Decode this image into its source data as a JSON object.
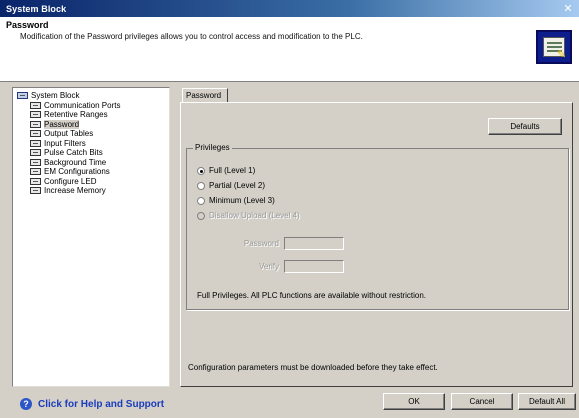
{
  "window": {
    "title": "System Block",
    "close_icon": "close-icon"
  },
  "header": {
    "title": "Password",
    "description": "Modification of the Password privileges allows you to control access and modification to the PLC."
  },
  "tree": {
    "root": "System Block",
    "items": [
      {
        "label": "Communication Ports"
      },
      {
        "label": "Retentive Ranges"
      },
      {
        "label": "Password"
      },
      {
        "label": "Output Tables"
      },
      {
        "label": "Input Filters"
      },
      {
        "label": "Pulse Catch Bits"
      },
      {
        "label": "Background Time"
      },
      {
        "label": "EM Configurations"
      },
      {
        "label": "Configure LED"
      },
      {
        "label": "Increase Memory"
      }
    ],
    "selected": "Password"
  },
  "tab": {
    "label": "Password"
  },
  "panel": {
    "defaults_button": "Defaults",
    "group_label": "Privileges",
    "options": [
      {
        "label": "Full (Level 1)",
        "checked": true,
        "disabled": false
      },
      {
        "label": "Partial (Level 2)",
        "checked": false,
        "disabled": false
      },
      {
        "label": "Minimum (Level 3)",
        "checked": false,
        "disabled": false
      },
      {
        "label": "Disallow Upload (Level 4)",
        "checked": false,
        "disabled": true
      }
    ],
    "password_label": "Password",
    "verify_label": "Verify",
    "info": "Full Privileges. All PLC functions are available without restriction.",
    "footer_note": "Configuration parameters must be downloaded before they take effect."
  },
  "bottom": {
    "help": "Click for Help and Support",
    "ok": "OK",
    "cancel": "Cancel",
    "default_all": "Default All"
  }
}
